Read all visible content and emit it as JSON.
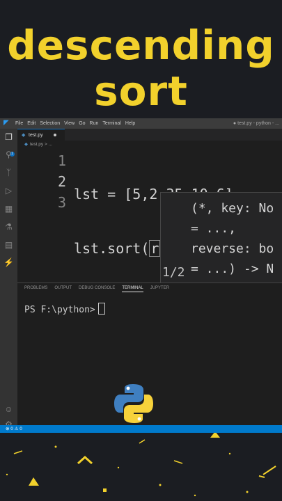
{
  "headline": {
    "line1": "descending",
    "line2": "sort"
  },
  "menu": {
    "items": [
      "File",
      "Edit",
      "Selection",
      "View",
      "Go",
      "Run",
      "Terminal",
      "Help"
    ],
    "window_title": "● test.py - python - ..."
  },
  "tab": {
    "label": "test.py",
    "icon": "python-file-icon"
  },
  "breadcrumb": {
    "file": "test.py",
    "sep": "> ..."
  },
  "editor": {
    "line_numbers": [
      "1",
      "2",
      "3"
    ],
    "lines": [
      "lst = [5,2,35,10,6]",
      "lst.sort(",
      "r",
      ")"
    ]
  },
  "hint": {
    "text": "(*, key: No\n= ...,\nreverse: bo\n= ...) -> N",
    "counter": "1/2"
  },
  "panel": {
    "tabs": [
      "PROBLEMS",
      "OUTPUT",
      "DEBUG CONSOLE",
      "TERMINAL",
      "JUPYTER"
    ],
    "prompt": "PS F:\\python>"
  },
  "status": {
    "text": "⊗ 0 ⚠ 0"
  },
  "colors": {
    "accent": "#f2d12c",
    "statusbar": "#007acc",
    "background": "#1b1d22"
  }
}
